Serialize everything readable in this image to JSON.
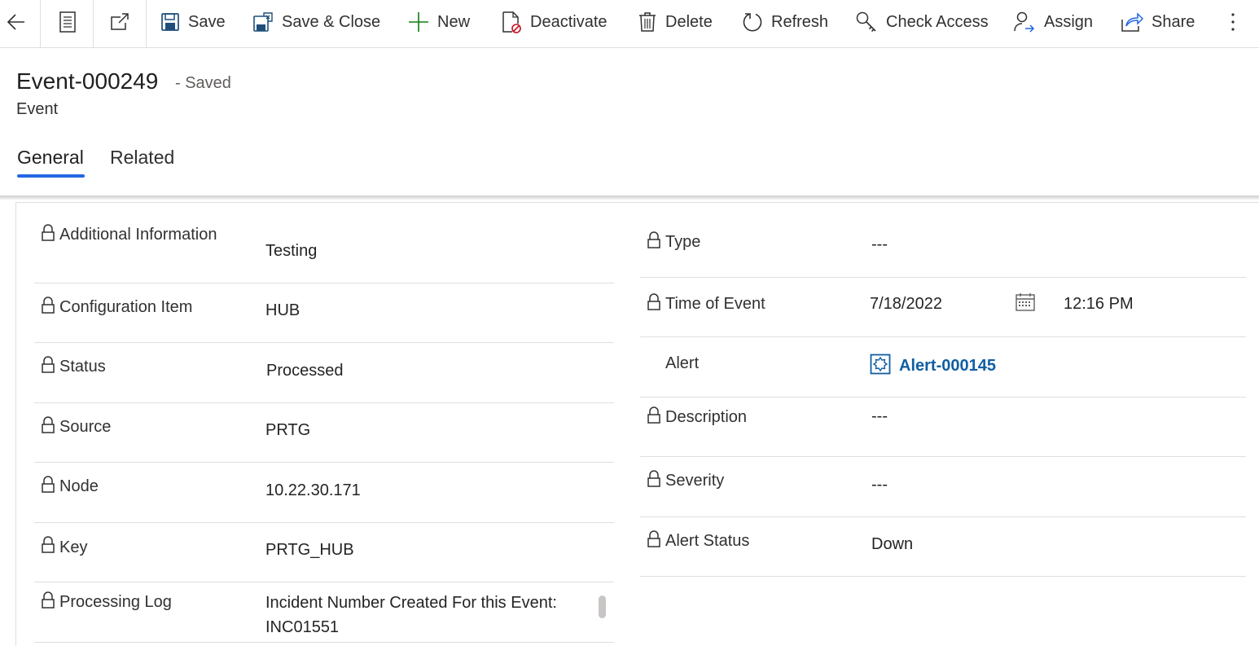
{
  "toolbar": {
    "back_icon": "arrow-left-icon",
    "form_icon": "form-icon",
    "popout_icon": "open-in-new-window-icon",
    "save": "Save",
    "save_close": "Save & Close",
    "new": "New",
    "deactivate": "Deactivate",
    "delete": "Delete",
    "refresh": "Refresh",
    "check_access": "Check Access",
    "assign": "Assign",
    "share": "Share",
    "more_icon": "more-vertical-icon"
  },
  "header": {
    "title": "Event-000249",
    "saved_status": "- Saved",
    "entity": "Event"
  },
  "tabs": [
    {
      "label": "General",
      "active": true
    },
    {
      "label": "Related",
      "active": false
    }
  ],
  "left_fields": [
    {
      "label": "Additional Information",
      "value": "Testing",
      "locked": true
    },
    {
      "label": "Configuration Item",
      "value": "HUB",
      "locked": true
    },
    {
      "label": "Status",
      "value": "Processed",
      "locked": true
    },
    {
      "label": "Source",
      "value": "PRTG",
      "locked": true
    },
    {
      "label": "Node",
      "value": "10.22.30.171",
      "locked": true
    },
    {
      "label": "Key",
      "value": "PRTG_HUB",
      "locked": true
    },
    {
      "label": "Processing Log",
      "value_line1": "Incident Number Created For this Event:",
      "value_line2": "INC01551",
      "locked": true
    }
  ],
  "right_fields": [
    {
      "label": "Type",
      "value": "---",
      "locked": true
    },
    {
      "label": "Time of Event",
      "date": "7/18/2022",
      "time": "12:16 PM",
      "locked": true
    },
    {
      "label": "Alert",
      "value": "Alert-000145",
      "locked": false,
      "is_link": true
    },
    {
      "label": "Description",
      "value": "---",
      "locked": true
    },
    {
      "label": "Severity",
      "value": "---",
      "locked": true
    },
    {
      "label": "Alert Status",
      "value": "Down",
      "locked": true
    }
  ],
  "colors": {
    "accent": "#2266e3",
    "link": "#115ea3",
    "new_plus": "#107c10",
    "divider": "#e1dfdd"
  }
}
